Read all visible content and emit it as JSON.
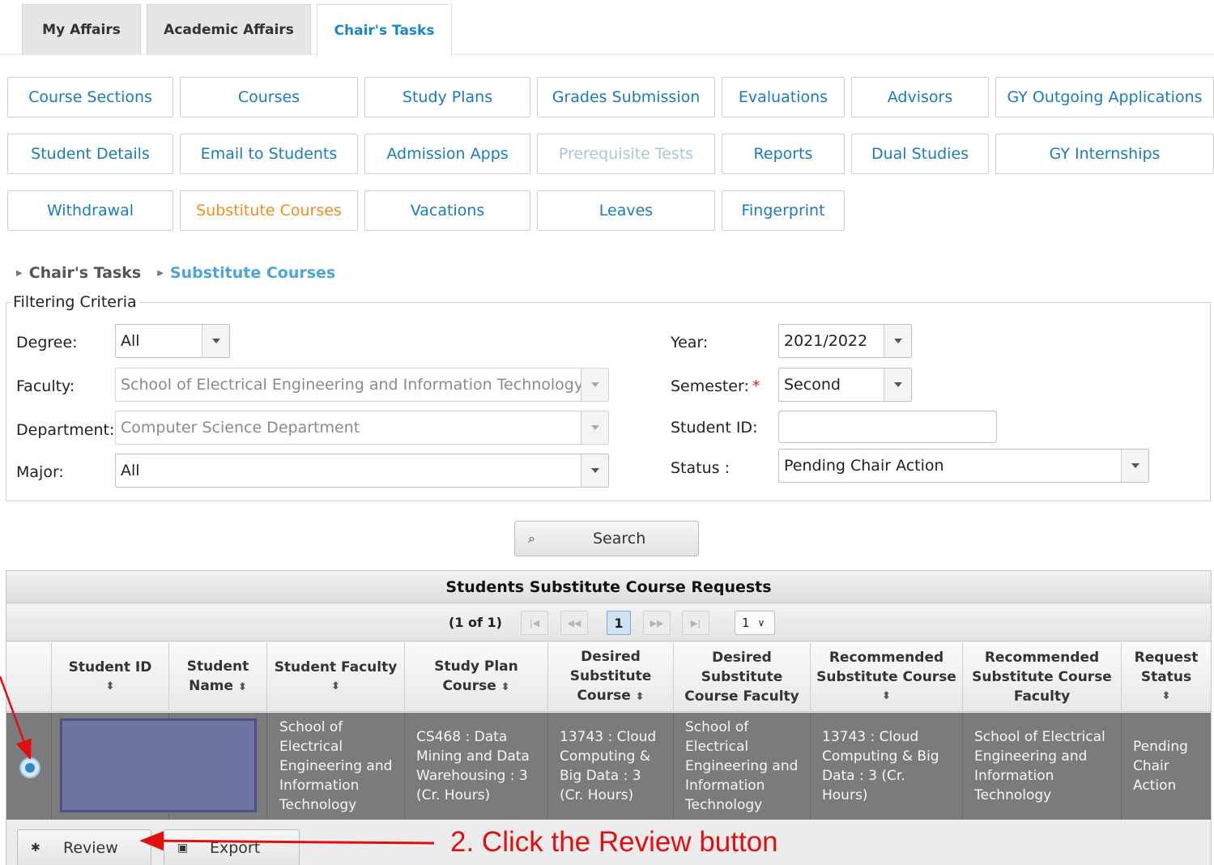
{
  "tabs": [
    {
      "label": "My Affairs"
    },
    {
      "label": "Academic Affairs"
    },
    {
      "label": "Chair's Tasks"
    }
  ],
  "nav": {
    "row1": [
      "Course Sections",
      "Courses",
      "Study Plans",
      "Grades Submission",
      "Evaluations",
      "Advisors",
      "GY Outgoing Applications"
    ],
    "row2": [
      "Student Details",
      "Email to Students",
      "Admission Apps",
      "Prerequisite Tests",
      "Reports",
      "Dual Studies",
      "GY Internships"
    ],
    "row3": [
      "Withdrawal",
      "Substitute Courses",
      "Vacations",
      "Leaves",
      "Fingerprint"
    ]
  },
  "breadcrumb": {
    "parent": "Chair's Tasks",
    "current": "Substitute Courses"
  },
  "filter": {
    "legend": "Filtering Criteria",
    "degree_label": "Degree:",
    "degree_value": "All",
    "faculty_label": "Faculty:",
    "faculty_value": "School of Electrical Engineering and Information Technology",
    "department_label": "Department:",
    "department_value": "Computer Science Department",
    "major_label": "Major:",
    "major_value": "All",
    "year_label": "Year:",
    "year_value": "2021/2022",
    "semester_label": "Semester:",
    "semester_required": "*",
    "semester_value": "Second",
    "studentid_label": "Student ID:",
    "studentid_value": "",
    "status_label": "Status :",
    "status_value": "Pending Chair Action",
    "search_label": "Search"
  },
  "table": {
    "title": "Students Substitute Course Requests",
    "page_info": "(1 of 1)",
    "current_page": "1",
    "rows_per_page": "1",
    "headers": [
      {
        "line1": "Student ID",
        "line2": "",
        "line3": ""
      },
      {
        "line1": "Student",
        "line2": "Name",
        "line3": ""
      },
      {
        "line1": "Student Faculty",
        "line2": "",
        "line3": ""
      },
      {
        "line1": "Study Plan",
        "line2": "Course",
        "line3": ""
      },
      {
        "line1": "Desired",
        "line2": "Substitute",
        "line3": "Course"
      },
      {
        "line1": "Desired",
        "line2": "Substitute",
        "line3": "Course Faculty"
      },
      {
        "line1": "Recommended",
        "line2": "Substitute Course",
        "line3": ""
      },
      {
        "line1": "Recommended",
        "line2": "Substitute Course",
        "line3": "Faculty"
      },
      {
        "line1": "Request",
        "line2": "Status",
        "line3": ""
      }
    ],
    "row": {
      "student_faculty": "School of Electrical Engineering and Information Technology",
      "study_plan_course": "CS468 : Data Mining and Data Warehousing : 3 (Cr. Hours)",
      "desired_course": "13743 : Cloud Computing & Big Data : 3 (Cr. Hours)",
      "desired_faculty": "School of Electrical Engineering and Information Technology",
      "recommended_course": "13743 : Cloud Computing & Big Data : 3 (Cr. Hours)",
      "recommended_faculty": "School of Electrical Engineering and Information Technology",
      "status": "Pending Chair Action"
    },
    "review_label": "Review",
    "export_label": "Export"
  },
  "annotation": "2. Click the Review button",
  "colors": {
    "link_blue": "#1a7bbf",
    "active_orange": "#f08c1e",
    "annotation_red": "#e01010"
  }
}
